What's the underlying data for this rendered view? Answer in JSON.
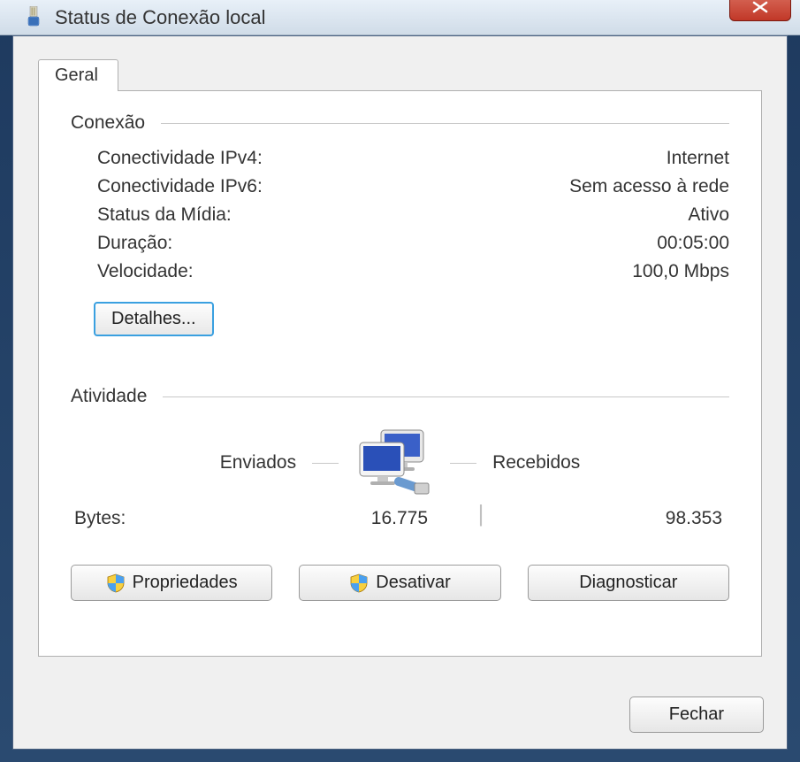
{
  "window": {
    "title": "Status de Conexão local"
  },
  "tab": {
    "general": "Geral"
  },
  "connection": {
    "header": "Conexão",
    "ipv4_label": "Conectividade IPv4:",
    "ipv4_value": "Internet",
    "ipv6_label": "Conectividade IPv6:",
    "ipv6_value": "Sem acesso à rede",
    "media_label": "Status da Mídia:",
    "media_value": "Ativo",
    "duration_label": "Duração:",
    "duration_value": "00:05:00",
    "speed_label": "Velocidade:",
    "speed_value": "100,0 Mbps",
    "details_button": "Detalhes..."
  },
  "activity": {
    "header": "Atividade",
    "sent_label": "Enviados",
    "received_label": "Recebidos",
    "bytes_label": "Bytes:",
    "bytes_sent": "16.775",
    "bytes_received": "98.353"
  },
  "buttons": {
    "properties": "Propriedades",
    "disable": "Desativar",
    "diagnose": "Diagnosticar",
    "close": "Fechar"
  }
}
